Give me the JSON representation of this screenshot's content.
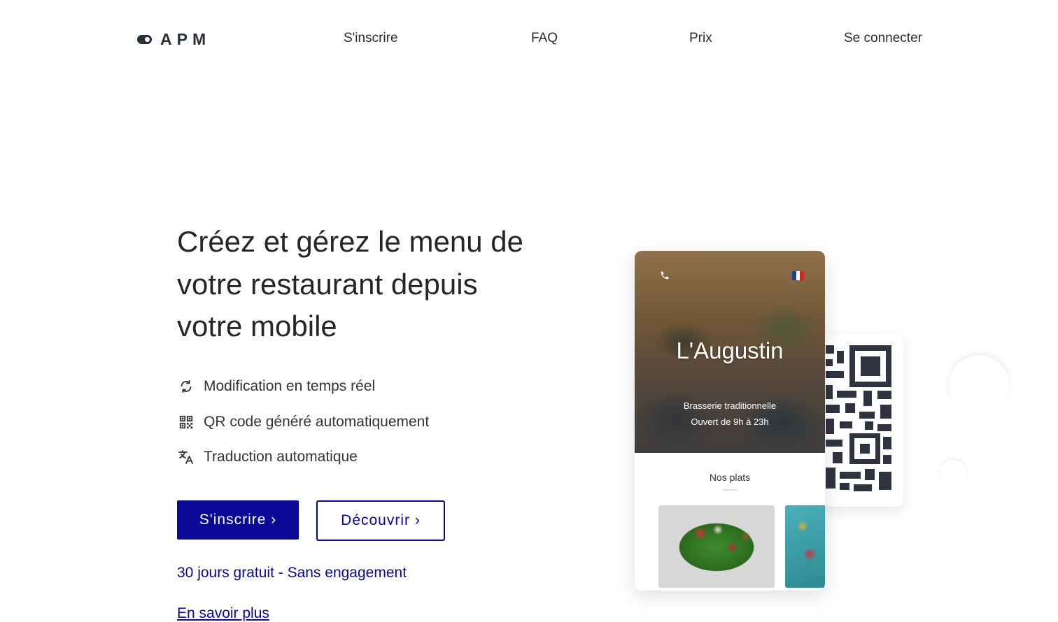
{
  "brand": {
    "name": "APM",
    "icon": "toggle-icon"
  },
  "nav": {
    "links": [
      {
        "label": "S'inscrire"
      },
      {
        "label": "FAQ"
      },
      {
        "label": "Prix"
      },
      {
        "label": "Se connecter"
      }
    ]
  },
  "hero": {
    "title": "Créez et gérez le menu de votre restaurant depuis votre mobile",
    "features": [
      {
        "icon": "sync-icon",
        "label": "Modification en temps réel"
      },
      {
        "icon": "qr-code-icon",
        "label": "QR code généré automatiquement"
      },
      {
        "icon": "translate-icon",
        "label": "Traduction automatique"
      }
    ],
    "primary_button": "S'inscrire ›",
    "secondary_button": "Découvrir ›",
    "trial_text": "30 jours gratuit - Sans engagement",
    "more_link": "En savoir plus"
  },
  "mockup": {
    "restaurant_name": "L'Augustin",
    "subtitle": "Brasserie traditionnelle",
    "hours": "Ouvert de 9h à 23h",
    "section_title": "Nos plats",
    "flag_colors": [
      "#1f3fa0",
      "#ffffff",
      "#d8232a"
    ],
    "phone_icon": "phone-icon"
  },
  "colors": {
    "accent": "#0a0896",
    "text": "#262626",
    "qr": "#2f3340"
  }
}
